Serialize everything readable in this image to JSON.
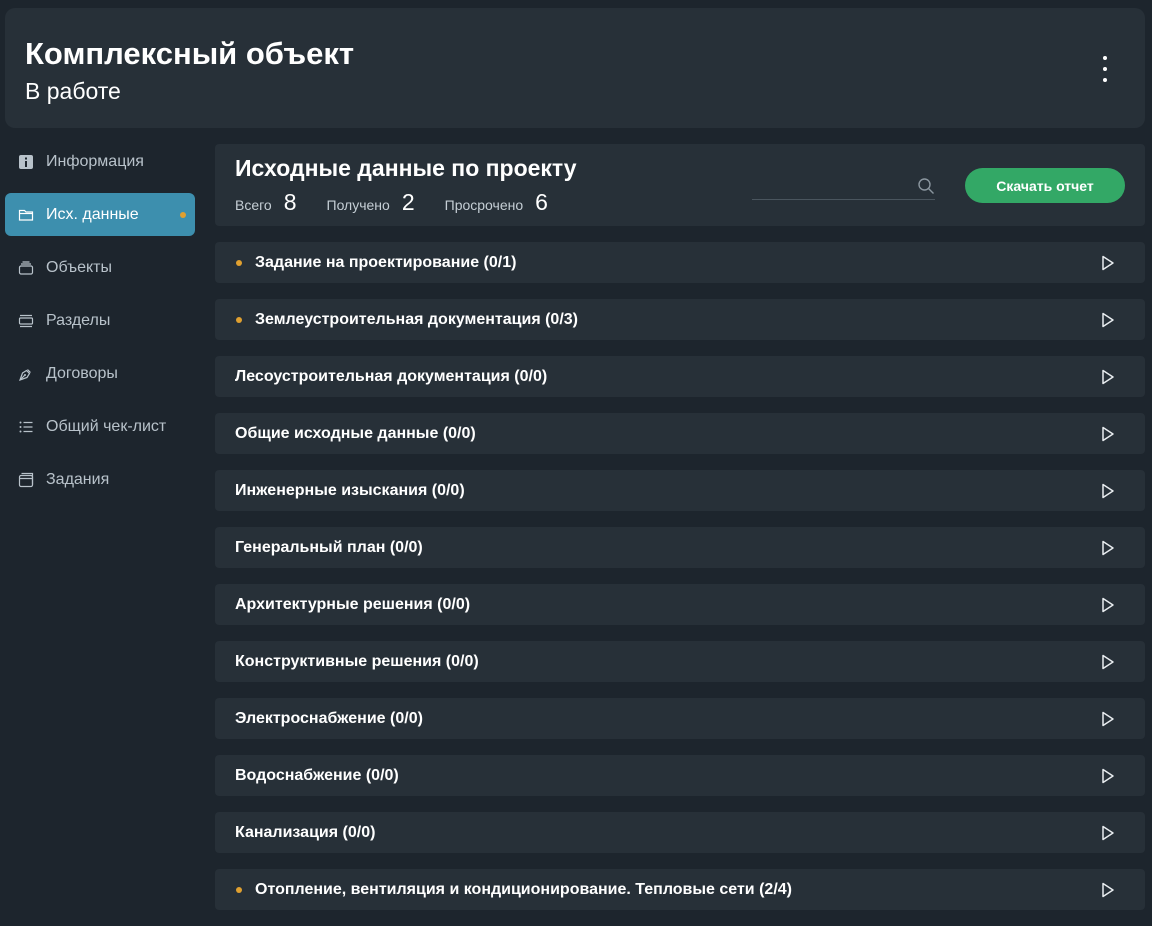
{
  "header": {
    "title": "Комплексный объект",
    "status": "В работе"
  },
  "sidebar": {
    "items": [
      {
        "label": "Информация",
        "icon": "info-icon",
        "active": false,
        "dot": false
      },
      {
        "label": "Исх. данные",
        "icon": "folder-icon",
        "active": true,
        "dot": true
      },
      {
        "label": "Объекты",
        "icon": "stack-icon",
        "active": false,
        "dot": false
      },
      {
        "label": "Разделы",
        "icon": "layers-icon",
        "active": false,
        "dot": false
      },
      {
        "label": "Договоры",
        "icon": "pen-nib-icon",
        "active": false,
        "dot": false
      },
      {
        "label": "Общий чек-лист",
        "icon": "checklist-icon",
        "active": false,
        "dot": false
      },
      {
        "label": "Задания",
        "icon": "tasks-icon",
        "active": false,
        "dot": false
      }
    ]
  },
  "panel": {
    "title": "Исходные данные по проекту",
    "stats": {
      "total_label": "Всего",
      "total": "8",
      "received_label": "Получено",
      "received": "2",
      "overdue_label": "Просрочено",
      "overdue": "6"
    },
    "search": {
      "placeholder": "",
      "value": ""
    },
    "download_label": "Скачать отчет"
  },
  "sections": [
    {
      "label": "Задание на проектирование (0/1)",
      "dot": true
    },
    {
      "label": "Землеустроительная документация (0/3)",
      "dot": true
    },
    {
      "label": "Лесоустроительная документация (0/0)",
      "dot": false
    },
    {
      "label": "Общие исходные данные (0/0)",
      "dot": false
    },
    {
      "label": "Инженерные изыскания (0/0)",
      "dot": false
    },
    {
      "label": "Генеральный план (0/0)",
      "dot": false
    },
    {
      "label": "Архитектурные решения (0/0)",
      "dot": false
    },
    {
      "label": "Конструктивные решения (0/0)",
      "dot": false
    },
    {
      "label": "Электроснабжение (0/0)",
      "dot": false
    },
    {
      "label": "Водоснабжение (0/0)",
      "dot": false
    },
    {
      "label": "Канализация (0/0)",
      "dot": false
    },
    {
      "label": "Отопление, вентиляция и кондиционирование. Тепловые сети (2/4)",
      "dot": true
    }
  ],
  "colors": {
    "background": "#1d252d",
    "card": "#273038",
    "accent_active": "#3d8fae",
    "primary_button": "#33a866",
    "warning_dot": "#e0a030"
  }
}
